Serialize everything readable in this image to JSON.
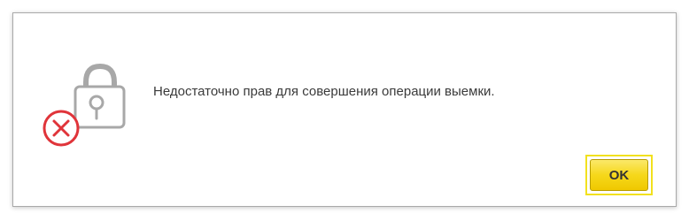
{
  "dialog": {
    "message": "Недостаточно прав для совершения операции выемки.",
    "icon": "lock-error-icon",
    "ok_label": "OK"
  },
  "colors": {
    "button_fill": "#f6d81b",
    "button_focus_frame": "#f2e11e",
    "error_red": "#e0343a",
    "lock_gray": "#a8a8a8"
  }
}
